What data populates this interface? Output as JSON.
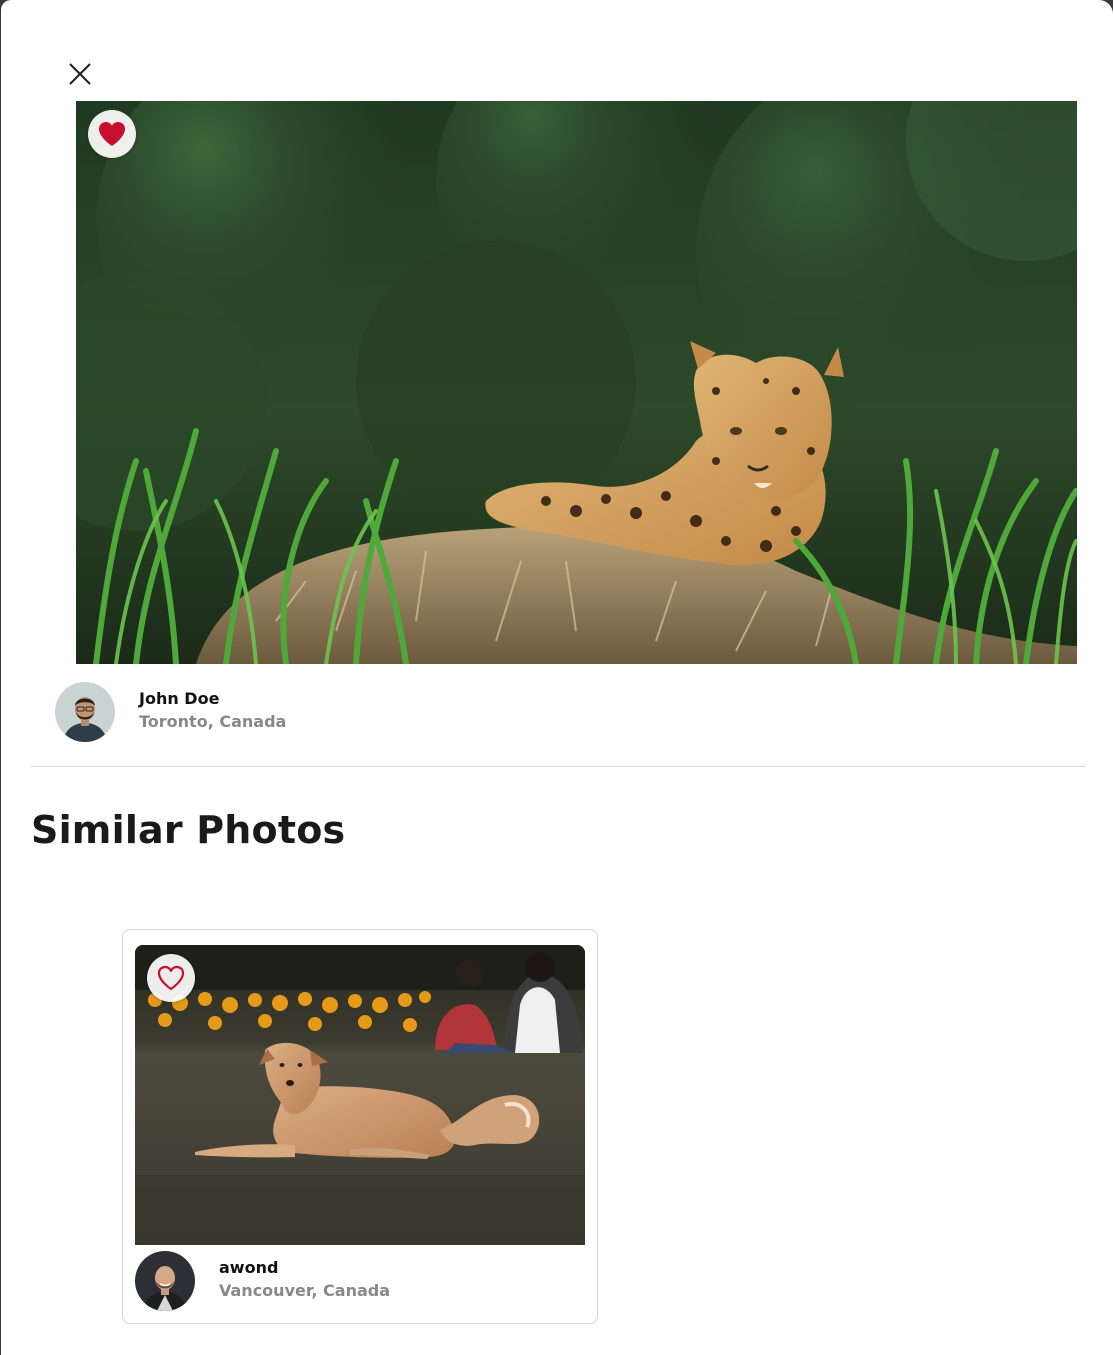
{
  "modal": {
    "close_icon": "close-icon",
    "hero": {
      "subject": "jaguar",
      "liked": true,
      "like_icon": "heart-filled-icon",
      "like_color": "#c8102e"
    },
    "author": {
      "name": "John Doe",
      "location": "Toronto, Canada"
    }
  },
  "similar": {
    "title": "Similar Photos",
    "cards": [
      {
        "subject": "dog",
        "liked": false,
        "like_icon": "heart-outline-icon",
        "like_color": "#c8102e",
        "author": {
          "name": "awond",
          "location": "Vancouver, Canada"
        }
      }
    ]
  }
}
